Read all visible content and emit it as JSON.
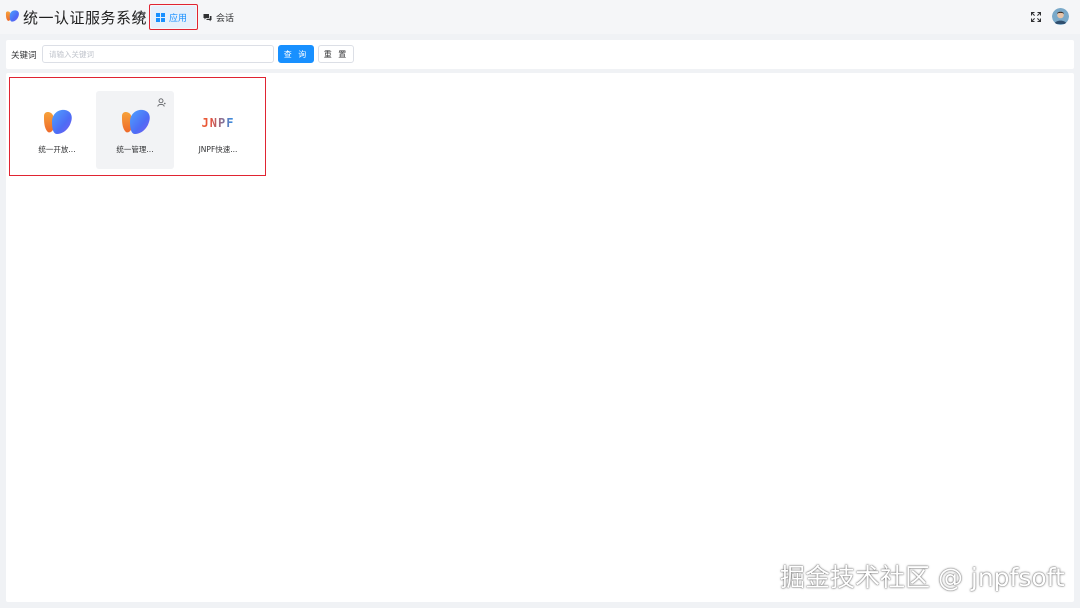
{
  "header": {
    "app_title": "统一认证服务系统",
    "logo_icon": "brand-logo-icon",
    "refresh_icon": "refresh-icon",
    "tabs": [
      {
        "label": "应用",
        "icon": "grid-icon",
        "active": true
      },
      {
        "label": "会话",
        "icon": "chat-icon",
        "active": false
      }
    ],
    "fullscreen_icon": "fullscreen-icon",
    "avatar_icon": "user-avatar"
  },
  "search": {
    "keyword_label": "关键词",
    "keyword_placeholder": "请输入关键词",
    "keyword_value": "",
    "query_label": "查 询",
    "reset_label": "重 置"
  },
  "apps": [
    {
      "name": "统一开放...",
      "logo": "brand-logo-icon",
      "badge": ""
    },
    {
      "name": "统一管理...",
      "logo": "brand-logo-icon",
      "badge": "user-icon"
    },
    {
      "name": "JNPF快速...",
      "logo": "jnpf-logo",
      "logo_text": "JNPF",
      "badge": ""
    }
  ],
  "watermark": "掘金技术社区 @ jnpfsoft",
  "colors": {
    "accent": "#1890ff",
    "highlight_frame": "#e02432",
    "page_bg": "#f0f2f5"
  }
}
